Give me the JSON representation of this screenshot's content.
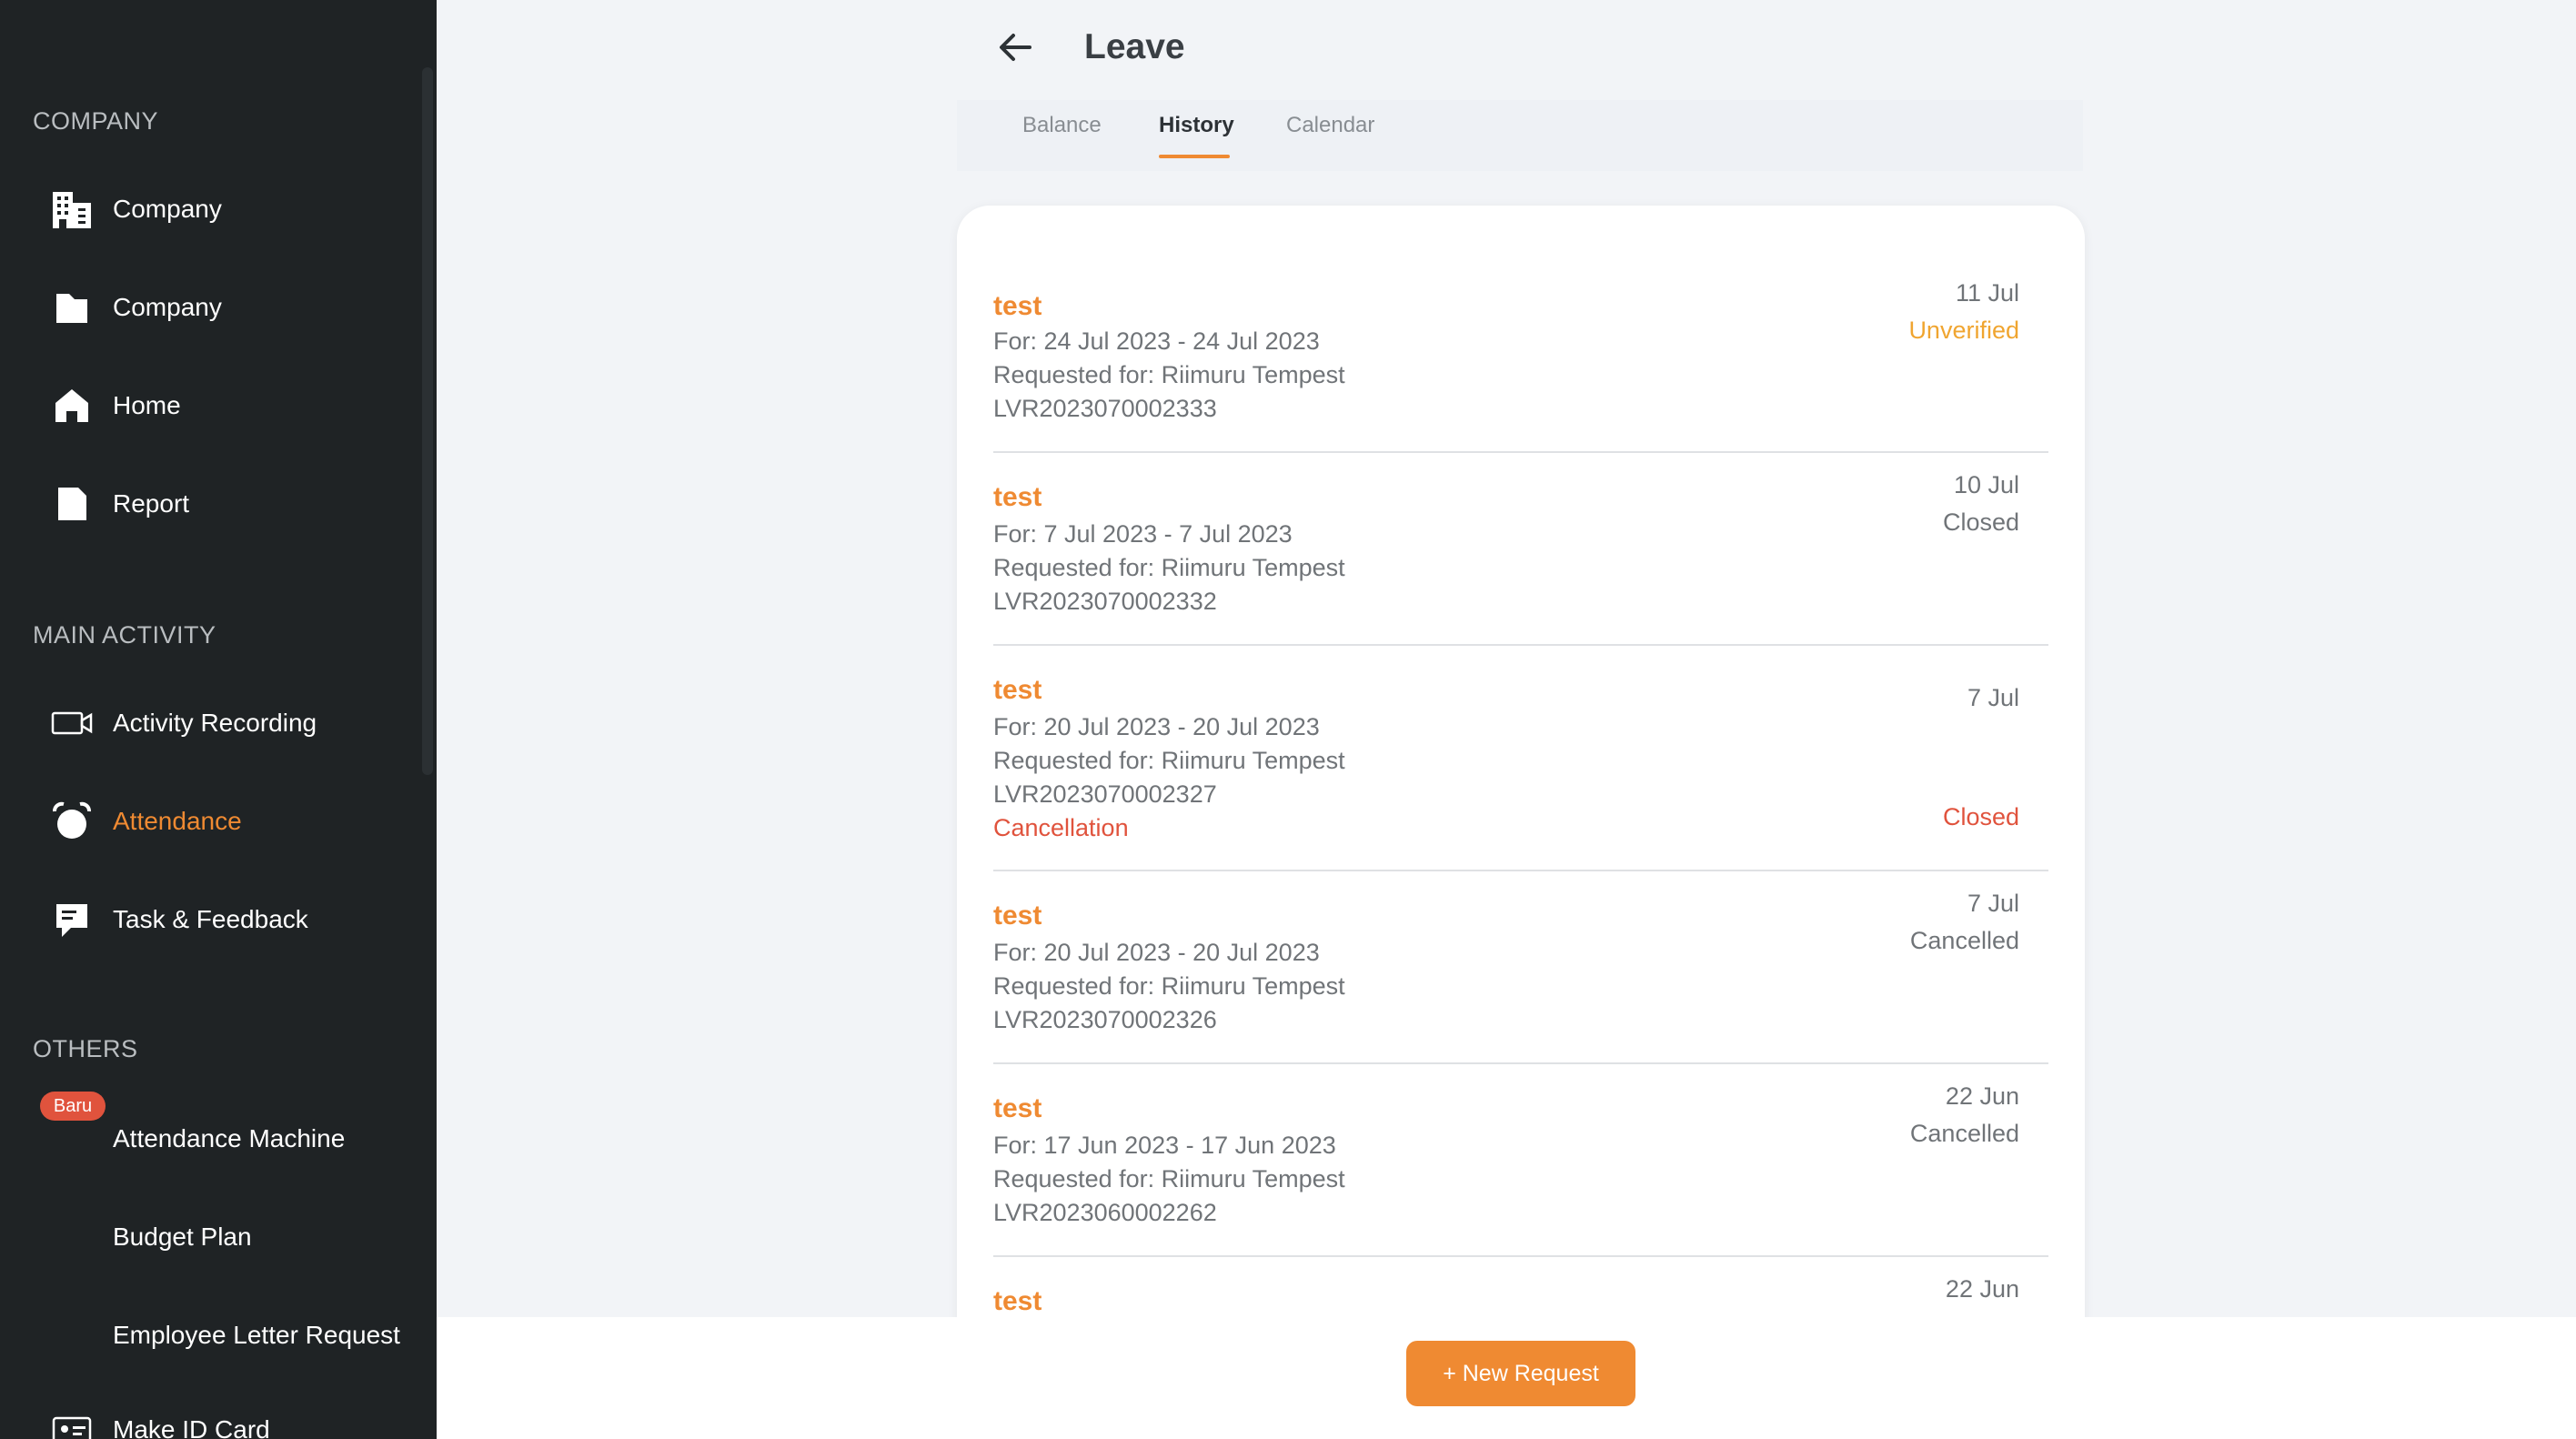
{
  "colors": {
    "sidebar_bg": "#1f2325",
    "accent": "#ef8a32",
    "unverified": "#f0a530",
    "danger": "#e0533d",
    "page_bg": "#f2f4f7"
  },
  "sidebar": {
    "sections": [
      {
        "title": "COMPANY"
      },
      {
        "title": "MAIN ACTIVITY"
      },
      {
        "title": "OTHERS"
      }
    ],
    "items": [
      {
        "label": "Company",
        "icon": "building-icon"
      },
      {
        "label": "Company",
        "icon": "folder-icon"
      },
      {
        "label": "Home",
        "icon": "home-icon"
      },
      {
        "label": "Report",
        "icon": "document-icon"
      },
      {
        "label": "Activity Recording",
        "icon": "video-camera-icon"
      },
      {
        "label": "Attendance",
        "icon": "alarm-clock-icon",
        "active": true
      },
      {
        "label": "Task & Feedback",
        "icon": "task-feedback-icon"
      },
      {
        "label": "Attendance Machine",
        "badge": "Baru"
      },
      {
        "label": "Budget Plan"
      },
      {
        "label": "Employee Letter Request"
      },
      {
        "label": "Make ID Card",
        "icon": "id-card-icon"
      }
    ]
  },
  "header": {
    "title": "Leave",
    "tabs": [
      "Balance",
      "History",
      "Calendar"
    ],
    "active_tab": "History"
  },
  "leave_requests": [
    {
      "title": "test",
      "period": "For: 24 Jul 2023 - 24 Jul 2023",
      "requested_for": "Requested for: Riimuru Tempest",
      "code": "LVR2023070002333",
      "date": "11 Jul",
      "status": "Unverified"
    },
    {
      "title": "test",
      "period": "For: 7 Jul 2023 - 7 Jul 2023",
      "requested_for": "Requested for: Riimuru Tempest",
      "code": "LVR2023070002332",
      "date": "10 Jul",
      "status": "Closed"
    },
    {
      "title": "test",
      "period": "For: 20 Jul 2023 - 20 Jul 2023",
      "requested_for": "Requested for: Riimuru Tempest",
      "code": "LVR2023070002327",
      "type": "Cancellation",
      "date": "7 Jul",
      "status": "Closed"
    },
    {
      "title": "test",
      "period": "For: 20 Jul 2023 - 20 Jul 2023",
      "requested_for": "Requested for: Riimuru Tempest",
      "code": "LVR2023070002326",
      "date": "7 Jul",
      "status": "Cancelled"
    },
    {
      "title": "test",
      "period": "For: 17 Jun 2023 - 17 Jun 2023",
      "requested_for": "Requested for: Riimuru Tempest",
      "code": "LVR2023060002262",
      "date": "22 Jun",
      "status": "Cancelled"
    },
    {
      "title": "test",
      "date": "22 Jun"
    }
  ],
  "actions": {
    "new_request": "+ New Request"
  }
}
